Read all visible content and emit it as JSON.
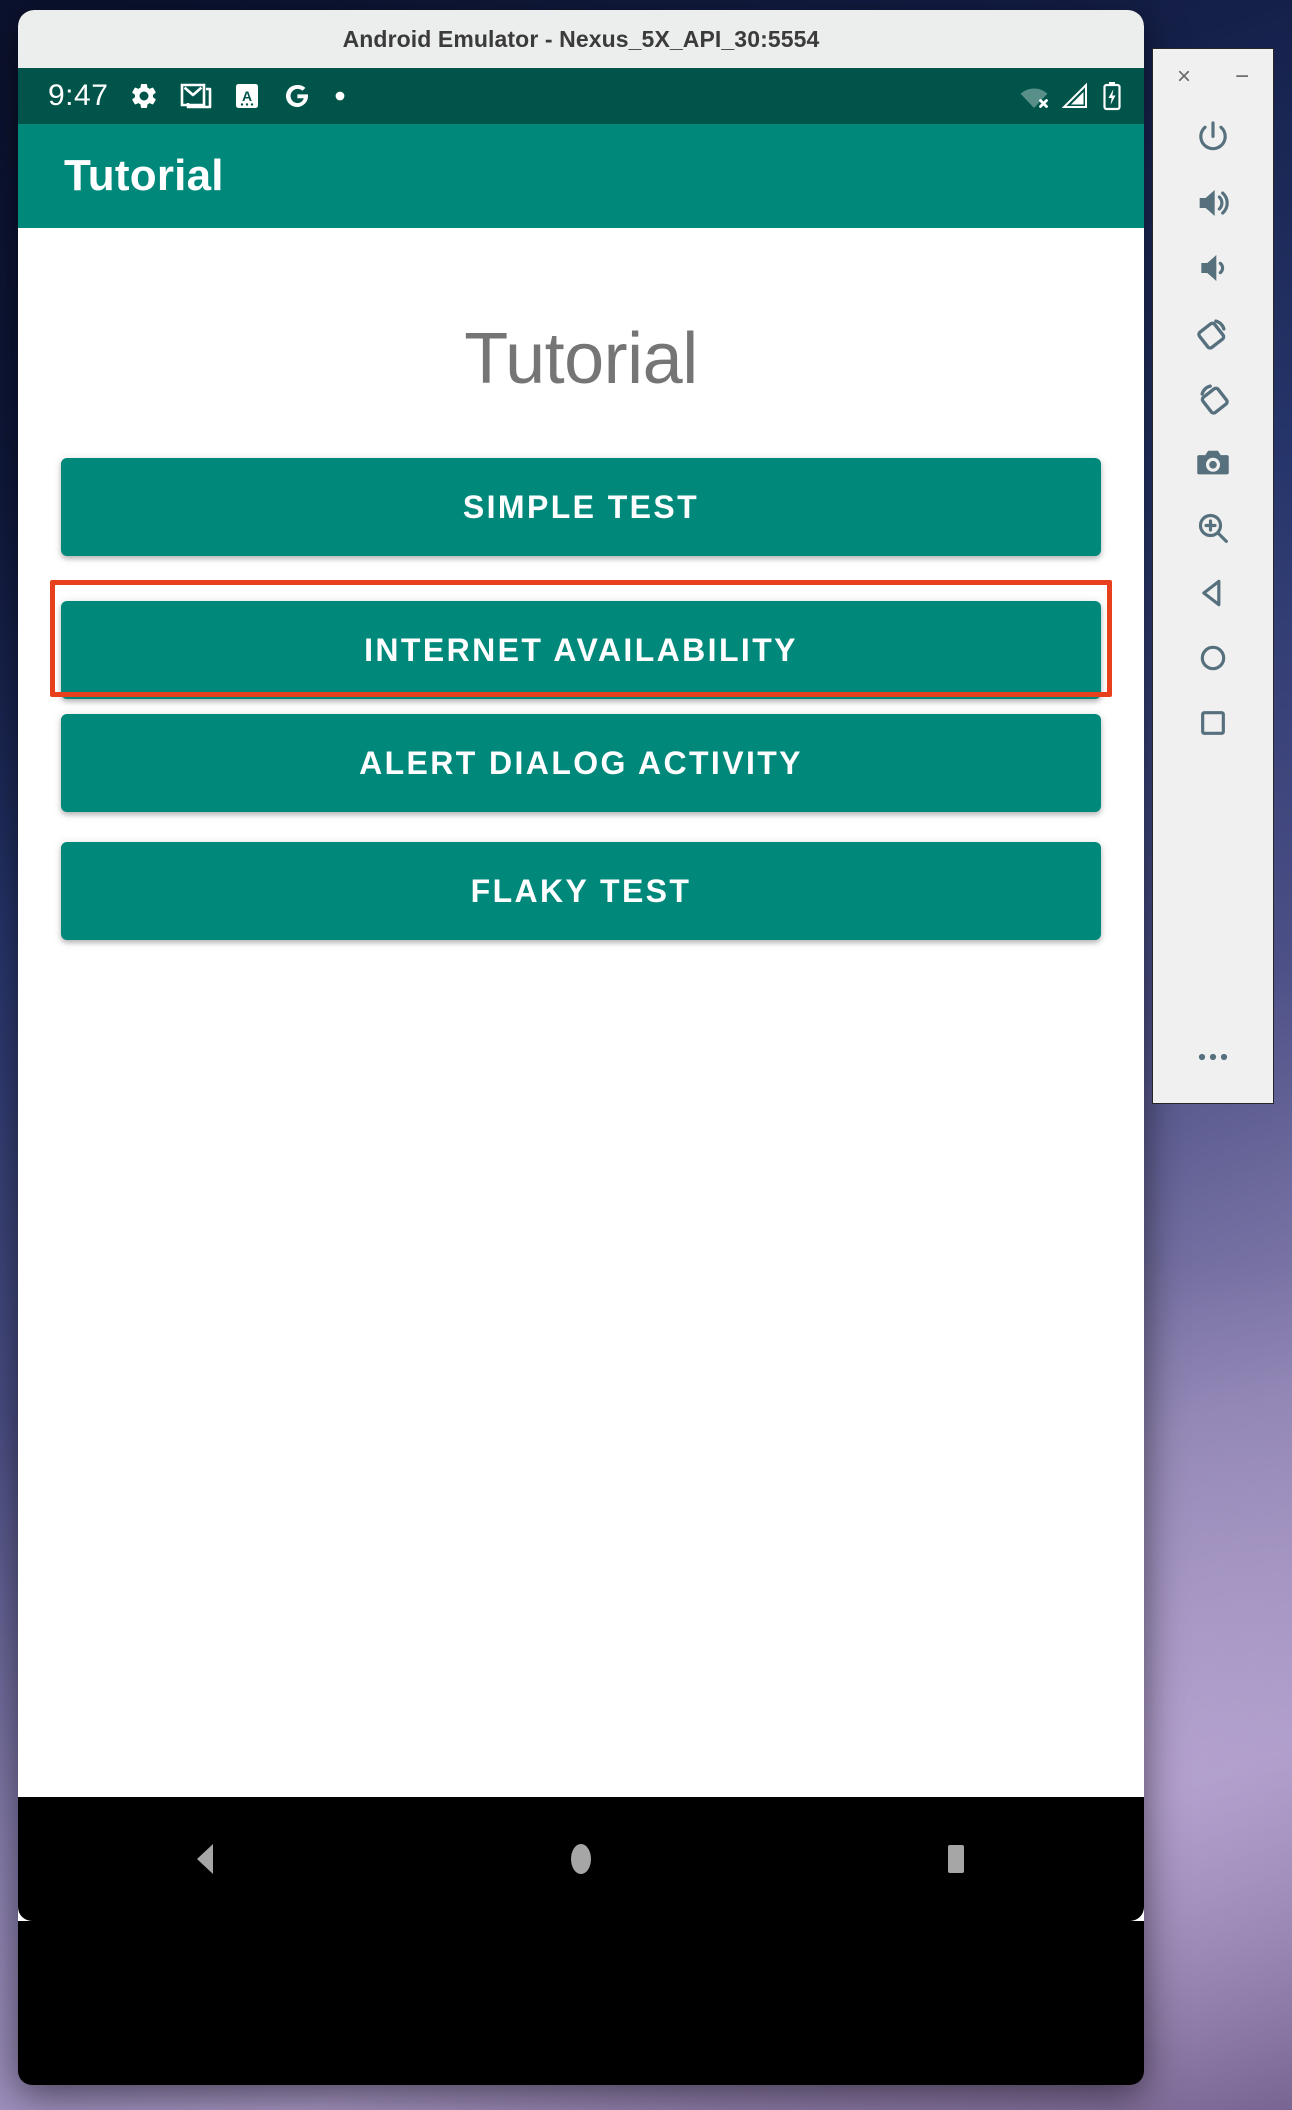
{
  "window": {
    "title": "Android Emulator - Nexus_5X_API_30:5554",
    "close_label": "×",
    "minimize_label": "−"
  },
  "status_bar": {
    "time": "9:47",
    "left_icons": [
      {
        "name": "settings-gear-icon"
      },
      {
        "name": "gmail-icon"
      },
      {
        "name": "app-a-icon"
      },
      {
        "name": "google-g-icon"
      },
      {
        "name": "notification-dot-icon"
      }
    ],
    "right_icons": [
      {
        "name": "wifi-off-icon"
      },
      {
        "name": "cellular-signal-icon"
      },
      {
        "name": "battery-charging-icon"
      }
    ]
  },
  "app_bar": {
    "title": "Tutorial"
  },
  "main": {
    "heading": "Tutorial",
    "buttons": [
      {
        "label": "SIMPLE TEST",
        "name": "simple-test-button",
        "highlighted": false
      },
      {
        "label": "INTERNET AVAILABILITY",
        "name": "internet-availability-button",
        "highlighted": true
      },
      {
        "label": "ALERT DIALOG ACTIVITY",
        "name": "alert-dialog-activity-button",
        "highlighted": false
      },
      {
        "label": "FLAKY TEST",
        "name": "flaky-test-button",
        "highlighted": false
      }
    ]
  },
  "nav_bar": {
    "items": [
      {
        "name": "android-back-button"
      },
      {
        "name": "android-home-button"
      },
      {
        "name": "android-recents-button"
      }
    ]
  },
  "side_toolbar": {
    "items": [
      {
        "name": "power-button"
      },
      {
        "name": "volume-up-button"
      },
      {
        "name": "volume-down-button"
      },
      {
        "name": "rotate-left-button"
      },
      {
        "name": "rotate-right-button"
      },
      {
        "name": "screenshot-camera-button"
      },
      {
        "name": "zoom-magnifier-button"
      },
      {
        "name": "back-button"
      },
      {
        "name": "home-button"
      },
      {
        "name": "overview-button"
      },
      {
        "name": "more-ellipsis-button"
      }
    ]
  },
  "colors": {
    "status_bar": "#00544A",
    "app_bar": "#00897B",
    "button": "#00897B",
    "highlight_border": "#E8401C",
    "heading_text": "#757575",
    "titlebar": "#eceded"
  }
}
